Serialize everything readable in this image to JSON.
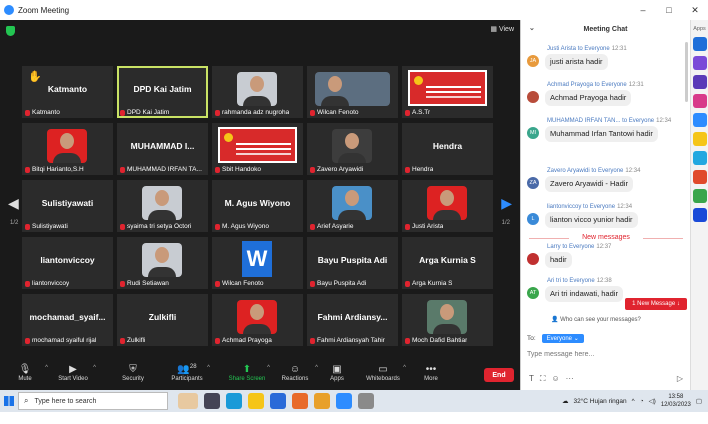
{
  "window": {
    "title": "Zoom Meeting",
    "view_label": "View"
  },
  "pager": {
    "left": "1/2",
    "right": "1/2"
  },
  "tiles": [
    {
      "big": "Katmanto",
      "name": "Katmanto",
      "kind": "name",
      "hand": true
    },
    {
      "big": "DPD Kai Jatim",
      "name": "DPD Kai Jatim",
      "kind": "name",
      "active": true
    },
    {
      "big": "",
      "name": "rahmanda adz nugroha",
      "kind": "face",
      "variant": "light"
    },
    {
      "big": "",
      "name": "Wilcan Fenoto",
      "kind": "face",
      "variant": "wide"
    },
    {
      "big": "",
      "name": "A.S.Tr",
      "kind": "slide"
    },
    {
      "big": "",
      "name": "Bitqi Harianto,S.H",
      "kind": "face",
      "variant": "red"
    },
    {
      "big": "MUHAMMAD I...",
      "name": "MUHAMMAD IRFAN TA...",
      "kind": "name"
    },
    {
      "big": "",
      "name": "Sbit Handoko",
      "kind": "slide"
    },
    {
      "big": "",
      "name": "Zavero Aryawidi",
      "kind": "face",
      "variant": "dark"
    },
    {
      "big": "Hendra",
      "name": "Hendra",
      "kind": "name"
    },
    {
      "big": "Sulistiyawati",
      "name": "Sulistiyawati",
      "kind": "name"
    },
    {
      "big": "",
      "name": "syaima tri setya Octori",
      "kind": "face",
      "variant": "light"
    },
    {
      "big": "M. Agus Wiyono",
      "name": "M. Agus Wiyono",
      "kind": "name"
    },
    {
      "big": "",
      "name": "Arief Asyarie",
      "kind": "face",
      "variant": "blue"
    },
    {
      "big": "",
      "name": "Justi Arista",
      "kind": "face",
      "variant": "red"
    },
    {
      "big": "liantonviccoy",
      "name": "liantonviccoy",
      "kind": "name"
    },
    {
      "big": "",
      "name": "Rudi Setiawan",
      "kind": "face",
      "variant": "light"
    },
    {
      "big": "",
      "name": "Wilcan Fenoto",
      "kind": "wlogo"
    },
    {
      "big": "Bayu Puspita Adi",
      "name": "Bayu Puspita Adi",
      "kind": "name"
    },
    {
      "big": "Arga Kurnia S",
      "name": "Arga Kurnia S",
      "kind": "name"
    },
    {
      "big": "mochamad_syaif...",
      "name": "mochamad syaiful rijal",
      "kind": "name"
    },
    {
      "big": "Zulkifli",
      "name": "Zulkifli",
      "kind": "name"
    },
    {
      "big": "",
      "name": "Achmad Prayoga",
      "kind": "face",
      "variant": "red"
    },
    {
      "big": "Fahmi Ardiansy...",
      "name": "Fahmi Ardiansyah Tahir",
      "kind": "name"
    },
    {
      "big": "",
      "name": "Moch Dafid Bahtiar",
      "kind": "face",
      "variant": "green"
    }
  ],
  "toolbar": {
    "mute": "Mute",
    "start_video": "Start Video",
    "security": "Security",
    "participants": "Participants",
    "participants_count": "28",
    "share_screen": "Share Screen",
    "reactions": "Reactions",
    "apps": "Apps",
    "whiteboards": "Whiteboards",
    "more": "More",
    "end": "End"
  },
  "chat": {
    "title": "Meeting Chat",
    "messages": [
      {
        "from": "Justi Arista",
        "to": "to Everyone",
        "time": "12:31",
        "text": "justi arista hadir",
        "initials": "JA",
        "color": "#e89a3c"
      },
      {
        "from": "Achmad Prayoga",
        "to": "to Everyone",
        "time": "12:31",
        "text": "Achmad Prayoga hadir",
        "initials": "",
        "color": "#b84c3a"
      },
      {
        "from": "MUHAMMAD IRFAN TAN...",
        "to": "to Everyone",
        "time": "12:34",
        "text": "Muhammad Irfan Tantowi hadir",
        "initials": "MI",
        "color": "#3aa68c"
      },
      {
        "from": "Zavero Aryawidi",
        "to": "to Everyone",
        "time": "12:34",
        "text": "Zavero Aryawidi - Hadir",
        "initials": "ZA",
        "color": "#4a6aa8"
      },
      {
        "from": "liantonviccoy",
        "to": "to Everyone",
        "time": "12:34",
        "text": "lianton vicco yunior hadir",
        "initials": "L",
        "color": "#3a8ad8"
      }
    ],
    "new_messages_label": "New messages",
    "new_messages": [
      {
        "from": "Larry",
        "to": "to Everyone",
        "time": "12:37",
        "text": "hadir",
        "initials": "",
        "color": "#c03030"
      },
      {
        "from": "Ari tri",
        "to": "to Everyone",
        "time": "12:38",
        "text": "Ari tri indawati, hadir",
        "initials": "AT",
        "color": "#3aa64c"
      }
    ],
    "new_message_button": "1 New Message",
    "who_can_see": "Who can see your messages?",
    "to_label": "To:",
    "to_value": "Everyone",
    "input_placeholder": "Type message here..."
  },
  "apps_panel": {
    "label": "Apps"
  },
  "taskbar": {
    "search_placeholder": "Type here to search",
    "weather": "32°C  Hujan ringan",
    "time": "13:58",
    "date": "12/03/2023"
  }
}
